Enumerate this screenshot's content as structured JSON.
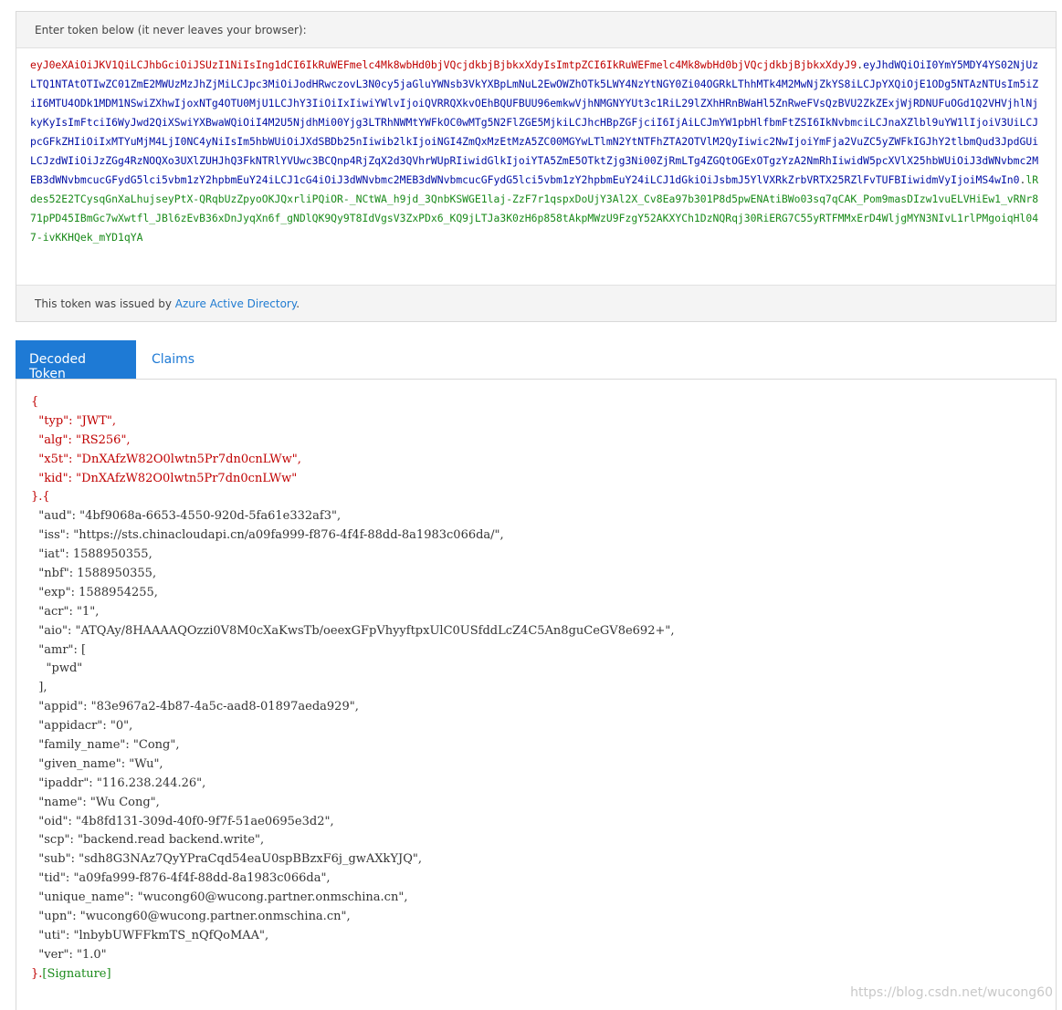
{
  "encoded": {
    "heading": "Enter token below (it never leaves your browser):",
    "header_part": "eyJ0eXAiOiJKV1QiLCJhbGciOiJSUzI1NiIsIng1dCI6IkRuWEFmelc4Mk8wbHd0bjVQcjdkbjBjbkxXdyIsImtpZCI6IkRuWEFmelc4Mk8wbHd0bjVQcjdkbjBjbkxXdyJ9",
    "dot1": ".",
    "payload_part": "eyJhdWQiOiI0YmY5MDY4YS02NjUzLTQ1NTAtOTIwZC01ZmE2MWUzMzJhZjMiLCJpc3MiOiJodHRwczovL3N0cy5jaGluYWNsb3VkYXBpLmNuL2EwOWZhOTk5LWY4NzYtNGY0Zi04OGRkLThhMTk4M2MwNjZkYS8iLCJpYXQiOjE1ODg5NTAzNTUsIm5iZiI6MTU4ODk1MDM1NSwiZXhwIjoxNTg4OTU0MjU1LCJhY3IiOiIxIiwiYWlvIjoiQVRRQXkvOEhBQUFBUU96emkwVjhNMGNYYUt3c1RiL29lZXhHRnBWaHl5ZnRweFVsQzBVU2ZkZExjWjRDNUFuOGd1Q2VHVjhlNjkyKyIsImFtciI6WyJwd2QiXSwiYXBwaWQiOiI4M2U5NjdhMi00Yjg3LTRhNWMtYWFkOC0wMTg5N2FlZGE5MjkiLCJhcHBpZGFjciI6IjAiLCJmYW1pbHlfbmFtZSI6IkNvbmciLCJnaXZlbl9uYW1lIjoiV3UiLCJpcGFkZHIiOiIxMTYuMjM4LjI0NC4yNiIsIm5hbWUiOiJXdSBDb25nIiwib2lkIjoiNGI4ZmQxMzEtMzA5ZC00MGYwLTlmN2YtNTFhZTA2OTVlM2QyIiwic2NwIjoiYmFja2VuZC5yZWFkIGJhY2tlbmQud3JpdGUiLCJzdWIiOiJzZGg4RzNOQXo3UXlZUHJhQ3FkNTRlYVUwc3BCQnp4RjZqX2d3QVhrWUpRIiwidGlkIjoiYTA5ZmE5OTktZjg3Ni00ZjRmLTg4ZGQtOGExOTgzYzA2NmRhIiwidW5pcXVlX25hbWUiOiJ3dWNvbmc2MEB3dWNvbmcucGFydG5lci5vbm1zY2hpbmEuY24iLCJ1cG4iOiJ3dWNvbmc2MEB3dWNvbmcucGFydG5lci5vbm1zY2hpbmEuY24iLCJ1dGkiOiJsbmJ5YlVXRkZrbVRTX25RZlFvTUFBIiwidmVyIjoiMS4wIn0",
    "dot2": ".",
    "signature_part": "lRdes52E2TCysqGnXaLhujseyPtX-QRqbUzZpyoOKJQxrliPQiOR-_NCtWA_h9jd_3QnbKSWGE1laj-ZzF7r1qspxDoUjY3Al2X_Cv8Ea97b301P8d5pwENAtiBWo03sq7qCAK_Pom9masDIzw1vuELVHiEw1_vRNr871pPD45IBmGc7wXwtfl_JBl6zEvB36xDnJyqXn6f_gNDlQK9Qy9T8IdVgsV3ZxPDx6_KQ9jLTJa3K0zH6p858tAkpMWzU9FzgY52AKXYCh1DzNQRqj30RiERG7C55yRTFMMxErD4WljgMYN3NIvL1rlPMgoiqHl047-ivKKHQek_mYD1qYA",
    "issuer_prefix": "This token was issued by ",
    "issuer_link": "Azure Active Directory",
    "issuer_suffix": "."
  },
  "tabs": [
    {
      "label": "Decoded Token",
      "active": true
    },
    {
      "label": "Claims",
      "active": false
    }
  ],
  "decoded": {
    "open_brace": "{",
    "header_fields": [
      {
        "key": "\"typ\"",
        "value": "\"JWT\","
      },
      {
        "key": "\"alg\"",
        "value": "\"RS256\","
      },
      {
        "key": "\"x5t\"",
        "value": "\"DnXAfzW82O0lwtn5Pr7dn0cnLWw\","
      },
      {
        "key": "\"kid\"",
        "value": "\"DnXAfzW82O0lwtn5Pr7dn0cnLWw\""
      }
    ],
    "mid_brace": "}.{",
    "payload_lines": [
      "  \"aud\": \"4bf9068a-6653-4550-920d-5fa61e332af3\",",
      "  \"iss\": \"https://sts.chinacloudapi.cn/a09fa999-f876-4f4f-88dd-8a1983c066da/\",",
      "  \"iat\": 1588950355,",
      "  \"nbf\": 1588950355,",
      "  \"exp\": 1588954255,",
      "  \"acr\": \"1\",",
      "  \"aio\": \"ATQAy/8HAAAAQOzzi0V8M0cXaKwsTb/oeexGFpVhyyftpxUlC0USfddLcZ4C5An8guCeGV8e692+\",",
      "  \"amr\": [",
      "    \"pwd\"",
      "  ],",
      "  \"appid\": \"83e967a2-4b87-4a5c-aad8-01897aeda929\",",
      "  \"appidacr\": \"0\",",
      "  \"family_name\": \"Cong\",",
      "  \"given_name\": \"Wu\",",
      "  \"ipaddr\": \"116.238.244.26\",",
      "  \"name\": \"Wu Cong\",",
      "  \"oid\": \"4b8fd131-309d-40f0-9f7f-51ae0695e3d2\",",
      "  \"scp\": \"backend.read backend.write\",",
      "  \"sub\": \"sdh8G3NAz7QyYPraCqd54eaU0spBBzxF6j_gwAXkYJQ\",",
      "  \"tid\": \"a09fa999-f876-4f4f-88dd-8a1983c066da\",",
      "  \"unique_name\": \"wucong60@wucong.partner.onmschina.cn\",",
      "  \"upn\": \"wucong60@wucong.partner.onmschina.cn\",",
      "  \"uti\": \"lnbybUWFFkmTS_nQfQoMAA\",",
      "  \"ver\": \"1.0\""
    ],
    "close_brace": "}.",
    "signature": "[Signature]"
  },
  "watermark": "https://blog.csdn.net/wucong60"
}
